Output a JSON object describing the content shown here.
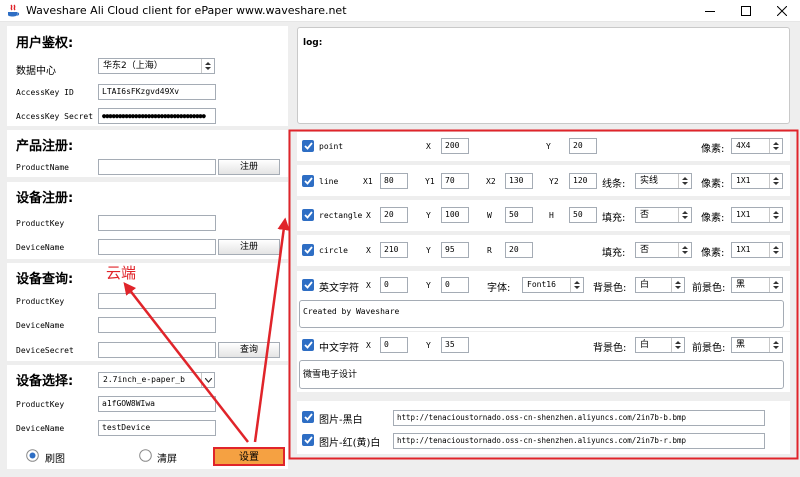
{
  "window": {
    "title": "Waveshare Ali Cloud client for ePaper   www.waveshare.net",
    "icon": "java-app-icon"
  },
  "auth": {
    "title": "用户鉴权:",
    "datacenter_label": "数据中心",
    "datacenter_value": "华东2（上海）",
    "accesskey_id_label": "AccessKey ID",
    "accesskey_id_value": "LTAI6sFKzgvd49Xv",
    "accesskey_secret_label": "AccessKey Secret",
    "accesskey_secret_value": "●●●●●●●●●●●●●●●●●●●●●●●●●●●●●●●●"
  },
  "product_register": {
    "title": "产品注册:",
    "productname_label": "ProductName",
    "productname_value": "",
    "register_button": "注册"
  },
  "device_register": {
    "title": "设备注册:",
    "productkey_label": "ProductKey",
    "productkey_value": "",
    "devicename_label": "DeviceName",
    "devicename_value": "",
    "register_button": "注册"
  },
  "device_query": {
    "title": "设备查询:",
    "productkey_label": "ProductKey",
    "productkey_value": "",
    "devicename_label": "DeviceName",
    "devicename_value": "",
    "devicesecret_label": "DeviceSecret",
    "devicesecret_value": "",
    "query_button": "查询"
  },
  "device_select": {
    "title": "设备选择:",
    "device_value": "2.7inch_e-paper_b",
    "productkey_label": "ProductKey",
    "productkey_value": "a1fGOW8WIwa",
    "devicename_label": "DeviceName",
    "devicename_value": "testDevice",
    "radio_refresh": "刷图",
    "radio_clear": "清屏",
    "settings_button": "设置"
  },
  "annotation": {
    "cloud_label": "云端",
    "color": "#e0242a"
  },
  "log": {
    "label": "log:"
  },
  "draw": {
    "x_label": "X",
    "y_label": "Y",
    "x1_label": "X1",
    "y1_label": "Y1",
    "x2_label": "X2",
    "y2_label": "Y2",
    "w_label": "W",
    "h_label": "H",
    "r_label": "R",
    "pixel_label": "像素:",
    "line_style_label": "线条:",
    "fill_label": "填充:",
    "font_label": "字体:",
    "bg_label": "背景色:",
    "fg_label": "前景色:",
    "point": {
      "label": "point",
      "x": "200",
      "y": "20",
      "pixel": "4X4"
    },
    "line": {
      "label": "line",
      "x1": "80",
      "y1": "70",
      "x2": "130",
      "y2": "120",
      "style": "实线",
      "pixel": "1X1"
    },
    "rectangle": {
      "label": "rectangle",
      "x": "20",
      "y": "100",
      "w": "50",
      "h": "50",
      "fill": "否",
      "pixel": "1X1"
    },
    "circle": {
      "label": "circle",
      "x": "210",
      "y": "95",
      "r": "20",
      "fill": "否",
      "pixel": "1X1"
    },
    "en_text": {
      "label": "英文字符",
      "x": "0",
      "y": "0",
      "font": "Font16",
      "bg": "白",
      "fg": "黑",
      "content": "Created by Waveshare"
    },
    "cn_text": {
      "label": "中文字符",
      "x": "0",
      "y": "35",
      "bg": "白",
      "fg": "黑",
      "content": "微雪电子设计"
    }
  },
  "images": {
    "bw_label": "图片-黑白",
    "bw_url": "http://tenacioustornado.oss-cn-shenzhen.aliyuncs.com/2in7b-b.bmp",
    "red_label": "图片-红(黄)白",
    "red_url": "http://tenacioustornado.oss-cn-shenzhen.aliyuncs.com/2in7b-r.bmp"
  },
  "colors": {
    "accent_red": "#e0242a",
    "checkbox_blue": "#2e6ec4",
    "settings_button": "#f5a142"
  }
}
